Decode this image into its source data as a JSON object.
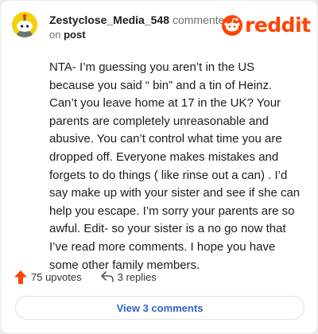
{
  "comment": {
    "username": "Zestyclose_Media_548",
    "action": "commented",
    "on_text": "on",
    "post_link": "post",
    "body": "NTA- I’m guessing you aren’t in the US because you said “ bin” and a tin of Heinz. Can’t you leave home at 17 in the UK? Your parents are completely unreasonable and abusive. You can’t control what time you are dropped off. Everyone makes mistakes and forgets to do things ( like rinse out a can) . I’d say make up with your sister and see if she can help you escape. I’m sorry your parents are so awful. Edit- so your sister is a no go now that I’ve read more comments. I hope you have some other family members."
  },
  "brand": {
    "wordmark": "reddit",
    "icon": "reddit-snoo-icon",
    "color": "#ff4500"
  },
  "stats": {
    "upvotes_label": "75 upvotes",
    "replies_label": "3 replies",
    "upvote_color": "#ff4500"
  },
  "actions": {
    "view_comments_label": "View 3 comments",
    "link_color": "#2f64c7"
  },
  "avatar": {
    "icon": "snoo-avatar-icon",
    "background": "#f2d20f"
  }
}
